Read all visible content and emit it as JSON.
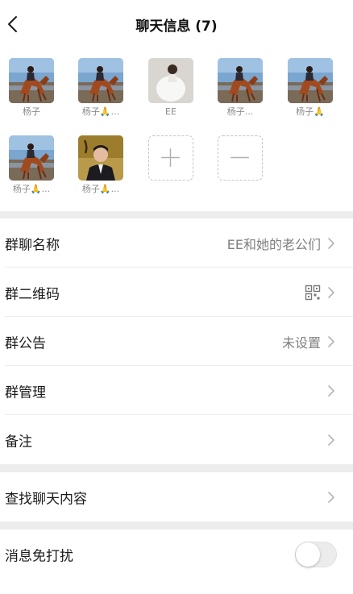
{
  "header": {
    "title": "聊天信息 (7)"
  },
  "members": [
    {
      "name": "杨子",
      "avatar": "horse-rider-photo"
    },
    {
      "name": "杨子🙏...",
      "avatar": "horse-rider-photo"
    },
    {
      "name": "EE",
      "avatar": "woman-photo"
    },
    {
      "name": "杨子...",
      "avatar": "horse-rider-photo"
    },
    {
      "name": "杨子🙏",
      "avatar": "horse-rider-photo"
    },
    {
      "name": "杨子🙏...",
      "avatar": "horse-rider-photo"
    },
    {
      "name": "杨子🙏...",
      "avatar": "man-suit-photo"
    }
  ],
  "member_controls": {
    "add": "+",
    "remove": "—"
  },
  "settings": {
    "group_name": {
      "label": "群聊名称",
      "value": "EE和她的老公们"
    },
    "qr_code": {
      "label": "群二维码",
      "icon": "qr-code-icon"
    },
    "announcement": {
      "label": "群公告",
      "value": "未设置"
    },
    "management": {
      "label": "群管理"
    },
    "remark": {
      "label": "备注"
    },
    "search": {
      "label": "查找聊天内容"
    },
    "mute": {
      "label": "消息免打扰",
      "enabled": false
    }
  },
  "colors": {
    "background": "#ffffff",
    "divider": "#ededed",
    "secondary_text": "#7f7f7f",
    "toggle_off": "#ececec"
  }
}
